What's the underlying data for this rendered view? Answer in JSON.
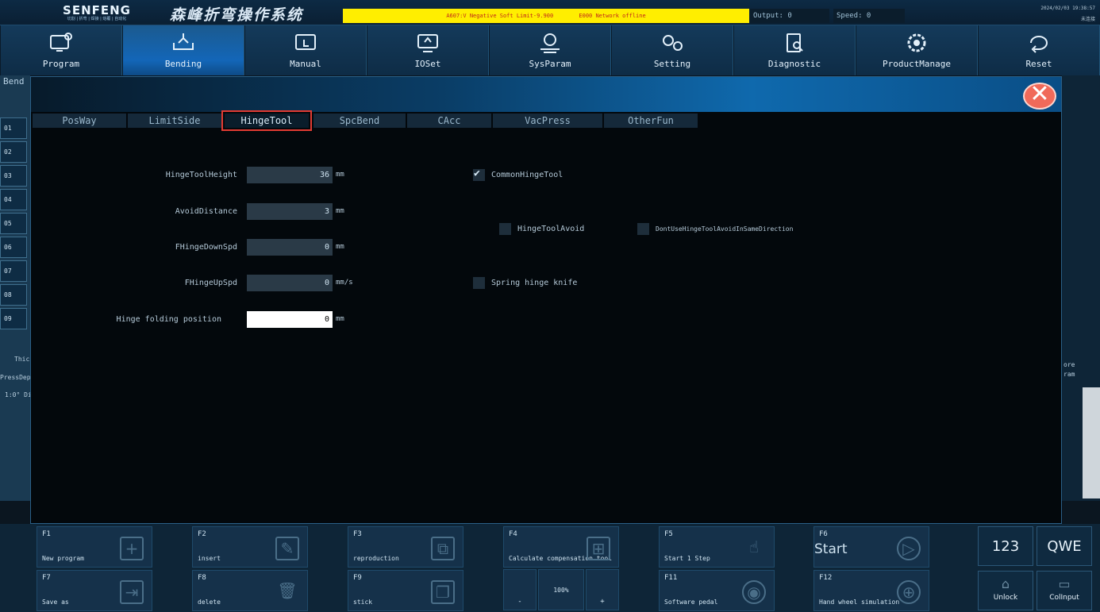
{
  "header": {
    "logo": "SENFENG",
    "logo_sub": "切割 | 折弯 | 焊接 | 熔覆 | 自动化",
    "title": "森峰折弯操作系统",
    "alarm1": "A607:V Negative Soft Limit-9.900",
    "alarm2": "E000 Network offline",
    "output": "Output: 0",
    "speed": "Speed: 0",
    "date": "2024/02/03 19:38:57",
    "conn": "未连接"
  },
  "nav": [
    {
      "label": "Program",
      "icon": "program-icon"
    },
    {
      "label": "Bending",
      "icon": "bending-icon"
    },
    {
      "label": "Manual",
      "icon": "manual-icon"
    },
    {
      "label": "IOSet",
      "icon": "ioset-icon"
    },
    {
      "label": "SysParam",
      "icon": "sysparam-icon"
    },
    {
      "label": "Setting",
      "icon": "setting-icon"
    },
    {
      "label": "Diagnostic",
      "icon": "diagnostic-icon"
    },
    {
      "label": "ProductManage",
      "icon": "productmanage-icon"
    },
    {
      "label": "Reset",
      "icon": "reset-icon"
    }
  ],
  "background": {
    "bend_label": "Bend",
    "rows": [
      "01",
      "02",
      "03",
      "04",
      "05",
      "06",
      "07",
      "08",
      "09"
    ],
    "side_text1": "Thic",
    "side_text2": "PressDep",
    "side_text3": "1:0° Di",
    "right_text": "ore\nram"
  },
  "dialog": {
    "tabs": [
      "PosWay",
      "LimitSide",
      "HingeTool",
      "SpcBend",
      "CAcc",
      "VacPress",
      "OtherFun"
    ],
    "active_tab": "HingeTool",
    "fields": [
      {
        "label": "HingeToolHeight",
        "value": "36",
        "unit": "mm"
      },
      {
        "label": "AvoidDistance",
        "value": "3",
        "unit": "mm"
      },
      {
        "label": "FHingeDownSpd",
        "value": "0",
        "unit": "mm"
      },
      {
        "label": "FHingeUpSpd",
        "value": "0",
        "unit": "mm/s"
      },
      {
        "label": "Hinge folding position",
        "value": "0",
        "unit": "mm"
      }
    ],
    "checkboxes": {
      "common": {
        "label": "CommonHingeTool",
        "checked": true
      },
      "avoid": {
        "label": "HingeToolAvoid",
        "checked": false
      },
      "dontuse": {
        "label": "DontUseHingeToolAvoidInSameDirection",
        "checked": false
      },
      "spring": {
        "label": "Spring hinge knife",
        "checked": false
      }
    },
    "close_label": "✕"
  },
  "footer": {
    "keys": [
      {
        "key": "F1",
        "label": "New program",
        "icon": "+"
      },
      {
        "key": "F2",
        "label": "insert",
        "icon": "✎"
      },
      {
        "key": "F3",
        "label": "reproduction",
        "icon": "⧉"
      },
      {
        "key": "F4",
        "label": "Calculate compensation tool",
        "icon": "⊞"
      },
      {
        "key": "F5",
        "label": "Start 1 Step",
        "icon": "☝"
      },
      {
        "key": "F6",
        "label": "Start",
        "icon": "▷"
      },
      {
        "key": "F7",
        "label": "Save as",
        "icon": "⇥"
      },
      {
        "key": "F8",
        "label": "delete",
        "icon": "🗑"
      },
      {
        "key": "F9",
        "label": "stick",
        "icon": "❐"
      },
      {
        "key": "F11",
        "label": "Software pedal",
        "icon": "◉"
      },
      {
        "key": "F12",
        "label": "Hand wheel simulation",
        "icon": "⊕"
      }
    ],
    "zoom_minus": "-",
    "zoom_value": "100%",
    "zoom_plus": "+",
    "kb_num": "123",
    "kb_alpha": "QWE",
    "unlock": "Unlock",
    "colinput": "ColInput"
  }
}
